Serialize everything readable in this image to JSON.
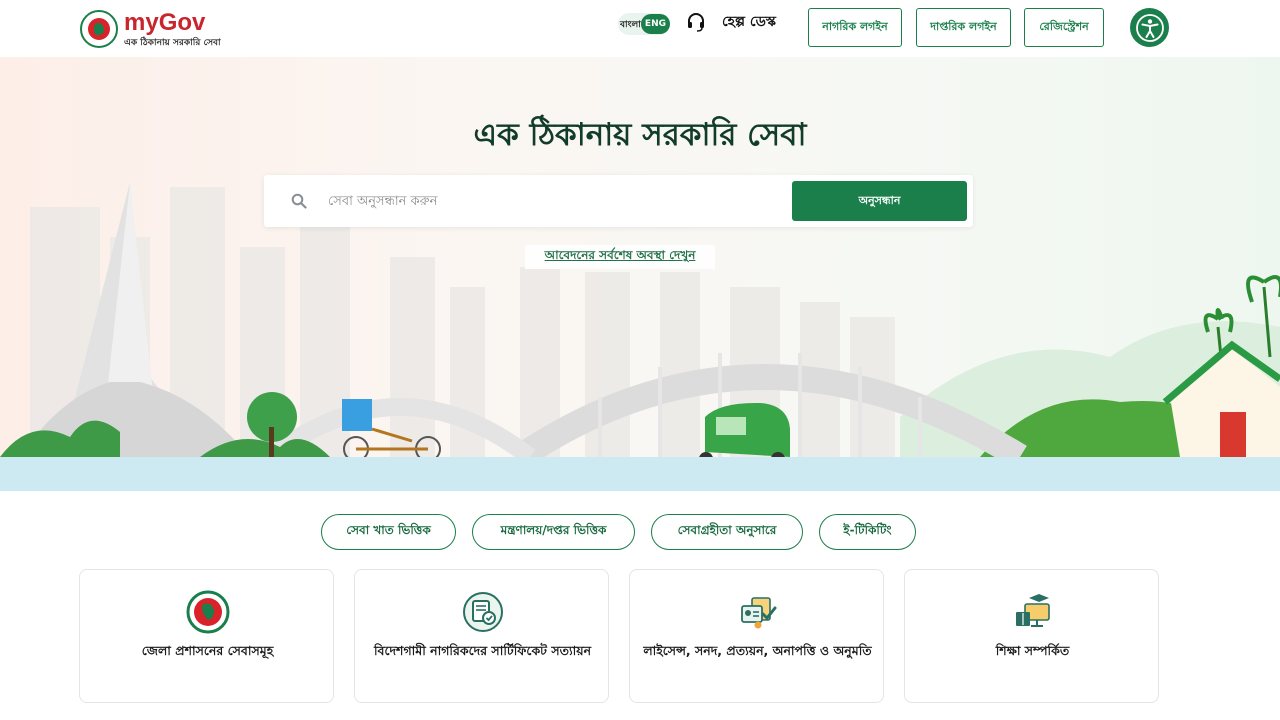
{
  "header": {
    "logo_brand": "myGov",
    "logo_tagline": "এক ঠিকানায় সরকারি সেবা",
    "lang_bn": "বাংলা",
    "lang_en": "ENG",
    "help_desk": "হেল্প ডেস্ক",
    "citizen_login": "নাগরিক লগইন",
    "official_login": "দাপ্তরিক লগইন",
    "registration": "রেজিস্ট্রেশন",
    "accessibility_icon": "accessibility-icon"
  },
  "hero": {
    "title": "এক ঠিকানায় সরকারি সেবা",
    "search_placeholder": "সেবা অনুসন্ধান করুন",
    "search_button": "অনুসন্ধান",
    "status_link": "আবেদনের সর্বশেষ অবস্থা দেখুন"
  },
  "tabs": [
    {
      "label": "সেবা খাত ভিত্তিক"
    },
    {
      "label": "মন্ত্রণালয়/দপ্তর ভিত্তিক"
    },
    {
      "label": "সেবাগ্রহীতা অনুসারে"
    },
    {
      "label": "ই-টিকিটিং"
    }
  ],
  "cards": [
    {
      "label": "জেলা প্রশাসনের সেবাসমূহ",
      "icon": "government-seal-icon"
    },
    {
      "label": "বিদেশগামী নাগরিকদের সার্টিফিকেট সত্যায়ন",
      "icon": "certificate-icon"
    },
    {
      "label": "লাইসেন্স, সনদ, প্রত্যয়ন, অনাপত্তি ও অনুমতি",
      "icon": "license-icon"
    },
    {
      "label": "শিক্ষা সম্পর্কিত",
      "icon": "education-icon"
    }
  ],
  "colors": {
    "primary": "#1a7f4b",
    "brand_red": "#c8262c",
    "water": "#cdeaf3"
  }
}
